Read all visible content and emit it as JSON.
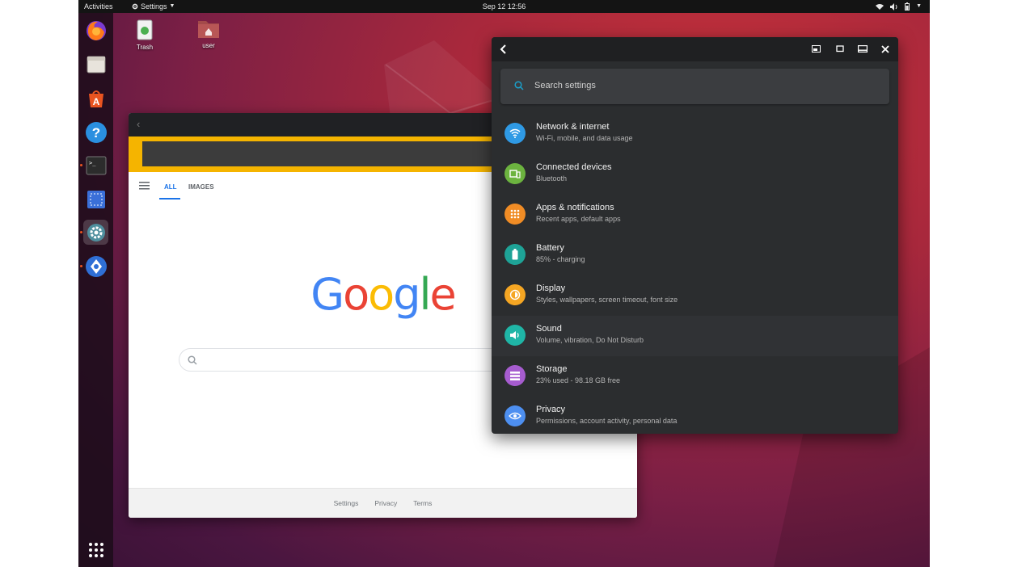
{
  "topbar": {
    "activities": "Activities",
    "app_menu": "Settings",
    "clock": "Sep 12  12:56"
  },
  "desktop": {
    "icons": [
      {
        "label": "Trash",
        "icon": "trash-icon"
      },
      {
        "label": "user",
        "icon": "home-folder-icon"
      }
    ]
  },
  "dock": {
    "items": [
      "firefox-icon",
      "files-icon",
      "software-icon",
      "help-icon",
      "terminal-icon",
      "screenshot-icon",
      "settings-icon",
      "anbox-icon"
    ],
    "show_apps": "show-apps-icon"
  },
  "browser": {
    "tabs": [
      "ALL",
      "IMAGES"
    ],
    "logo": [
      {
        "ch": "G",
        "color": "#4285F4"
      },
      {
        "ch": "o",
        "color": "#EA4335"
      },
      {
        "ch": "o",
        "color": "#FBBC05"
      },
      {
        "ch": "g",
        "color": "#4285F4"
      },
      {
        "ch": "l",
        "color": "#34A853"
      },
      {
        "ch": "e",
        "color": "#EA4335"
      }
    ],
    "footer": [
      "Settings",
      "Privacy",
      "Terms"
    ]
  },
  "settings": {
    "search_placeholder": "Search settings",
    "items": [
      {
        "title": "Network & internet",
        "subtitle": "Wi-Fi, mobile, and data usage",
        "icon": "wifi-icon",
        "color": "#2f9ae5"
      },
      {
        "title": "Connected devices",
        "subtitle": "Bluetooth",
        "icon": "devices-icon",
        "color": "#6cb33f"
      },
      {
        "title": "Apps & notifications",
        "subtitle": "Recent apps, default apps",
        "icon": "apps-grid-icon",
        "color": "#f08c25"
      },
      {
        "title": "Battery",
        "subtitle": "85% - charging",
        "icon": "battery-icon",
        "color": "#1ea397"
      },
      {
        "title": "Display",
        "subtitle": "Styles, wallpapers, screen timeout, font size",
        "icon": "brightness-icon",
        "color": "#f5a623"
      },
      {
        "title": "Sound",
        "subtitle": "Volume, vibration, Do Not Disturb",
        "icon": "volume-icon",
        "color": "#1fb5a6"
      },
      {
        "title": "Storage",
        "subtitle": "23% used - 98.18 GB free",
        "icon": "storage-icon",
        "color": "#a65ccf"
      },
      {
        "title": "Privacy",
        "subtitle": "Permissions, account activity, personal data",
        "icon": "privacy-eye-icon",
        "color": "#4d8ff0"
      }
    ]
  }
}
